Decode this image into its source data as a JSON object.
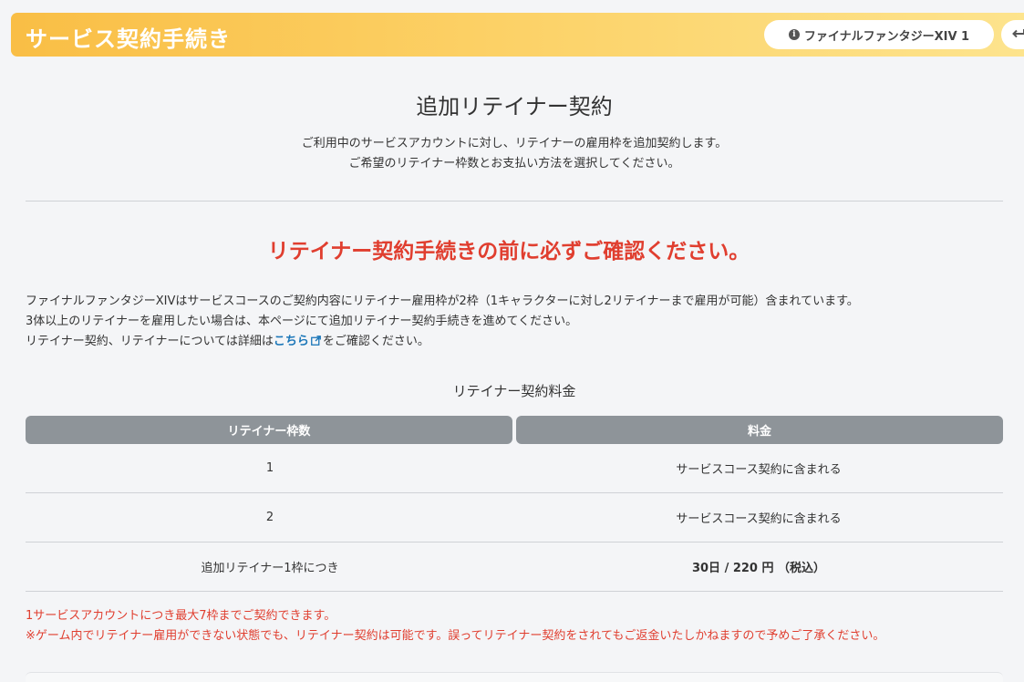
{
  "header": {
    "title": "サービス契約手続き",
    "account_label": "ファイナルファンタジーXIV 1",
    "info_icon": "info-icon",
    "logout_icon": "return-arrow-icon",
    "gradient_start": "#f9be45",
    "gradient_end": "#fde48e"
  },
  "page": {
    "title": "追加リテイナー契約",
    "intro_line1": "ご利用中のサービスアカウントに対し、リテイナーの雇用枠を追加契約します。",
    "intro_line2": "ご希望のリテイナー枠数とお支払い方法を選択してください。"
  },
  "warning": {
    "heading": "リテイナー契約手続きの前に必ずご確認ください。",
    "color": "#e03e2f"
  },
  "body": {
    "line1": "ファイナルファンタジーXIVはサービスコースのご契約内容にリテイナー雇用枠が2枠（1キャラクターに対し2リテイナーまで雇用が可能）含まれています。",
    "line2": "3体以上のリテイナーを雇用したい場合は、本ページにて追加リテイナー契約手続きを進めてください。",
    "line3_prefix": "リテイナー契約、リテイナーについては詳細は",
    "link_text": "こちら",
    "line3_suffix": "をご確認ください。",
    "link_color": "#1a76b8"
  },
  "fee_table": {
    "caption": "リテイナー契約料金",
    "headers": [
      "リテイナー枠数",
      "料金"
    ],
    "rows": [
      [
        "1",
        "サービスコース契約に含まれる"
      ],
      [
        "2",
        "サービスコース契約に含まれる"
      ],
      [
        "追加リテイナー1枠につき",
        "30日 / 220 円 （税込）"
      ]
    ]
  },
  "notes": {
    "line1": "1サービスアカウントにつき最大7枠までご契約できます。",
    "line2": "※ゲーム内でリテイナー雇用ができない状態でも、リテイナー契約は可能です。誤ってリテイナー契約をされてもご返金いたしかねますので予めご了承ください。"
  }
}
